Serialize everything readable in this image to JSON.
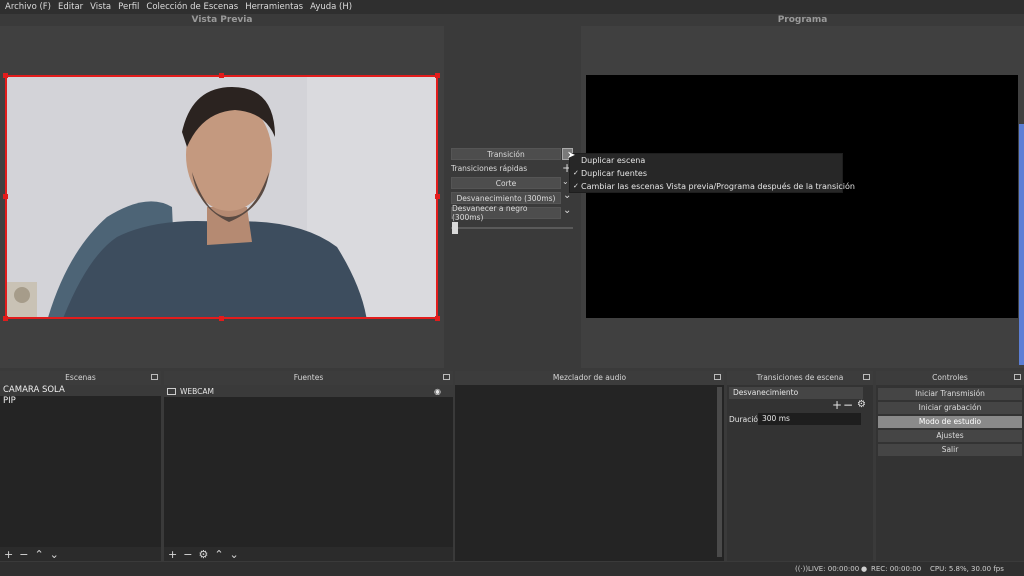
{
  "menu": [
    "Archivo (F)",
    "Editar",
    "Vista",
    "Perfil",
    "Colección de Escenas",
    "Herramientas",
    "Ayuda (H)"
  ],
  "preview_title": "Vista Previa",
  "program_title": "Programa",
  "transition": {
    "transition_label": "Transición",
    "quick_transitions_label": "Transiciones rápidas",
    "cut_label": "Corte",
    "fade_label": "Desvanecimiento (300ms)",
    "fade_black_label": "Desvanecer a negro (300ms)"
  },
  "context_menu": {
    "items": [
      {
        "label": "Duplicar escena",
        "checked": false
      },
      {
        "label": "Duplicar fuentes",
        "checked": true
      },
      {
        "label": "Cambiar las escenas Vista previa/Programa después de la transición",
        "checked": true
      }
    ]
  },
  "docks": {
    "scenes_title": "Escenas",
    "sources_title": "Fuentes",
    "mixer_title": "Mezclador de audio",
    "scene_transitions_title": "Transiciones de escena",
    "controls_title": "Controles"
  },
  "scenes": [
    "CAMARA SOLA",
    "PIP"
  ],
  "sources": [
    {
      "name": "WEBCAM"
    }
  ],
  "scene_transitions": {
    "selected": "Desvanecimiento",
    "duration_label": "Duración",
    "duration_value": "300 ms"
  },
  "controls": [
    "Iniciar Transmisión",
    "Iniciar grabación",
    "Modo de estudio",
    "Ajustes",
    "Salir"
  ],
  "status": {
    "live": "LIVE: 00:00:00",
    "rec": "REC: 00:00:00",
    "cpu": "CPU: 5.8%, 30.00 fps"
  }
}
